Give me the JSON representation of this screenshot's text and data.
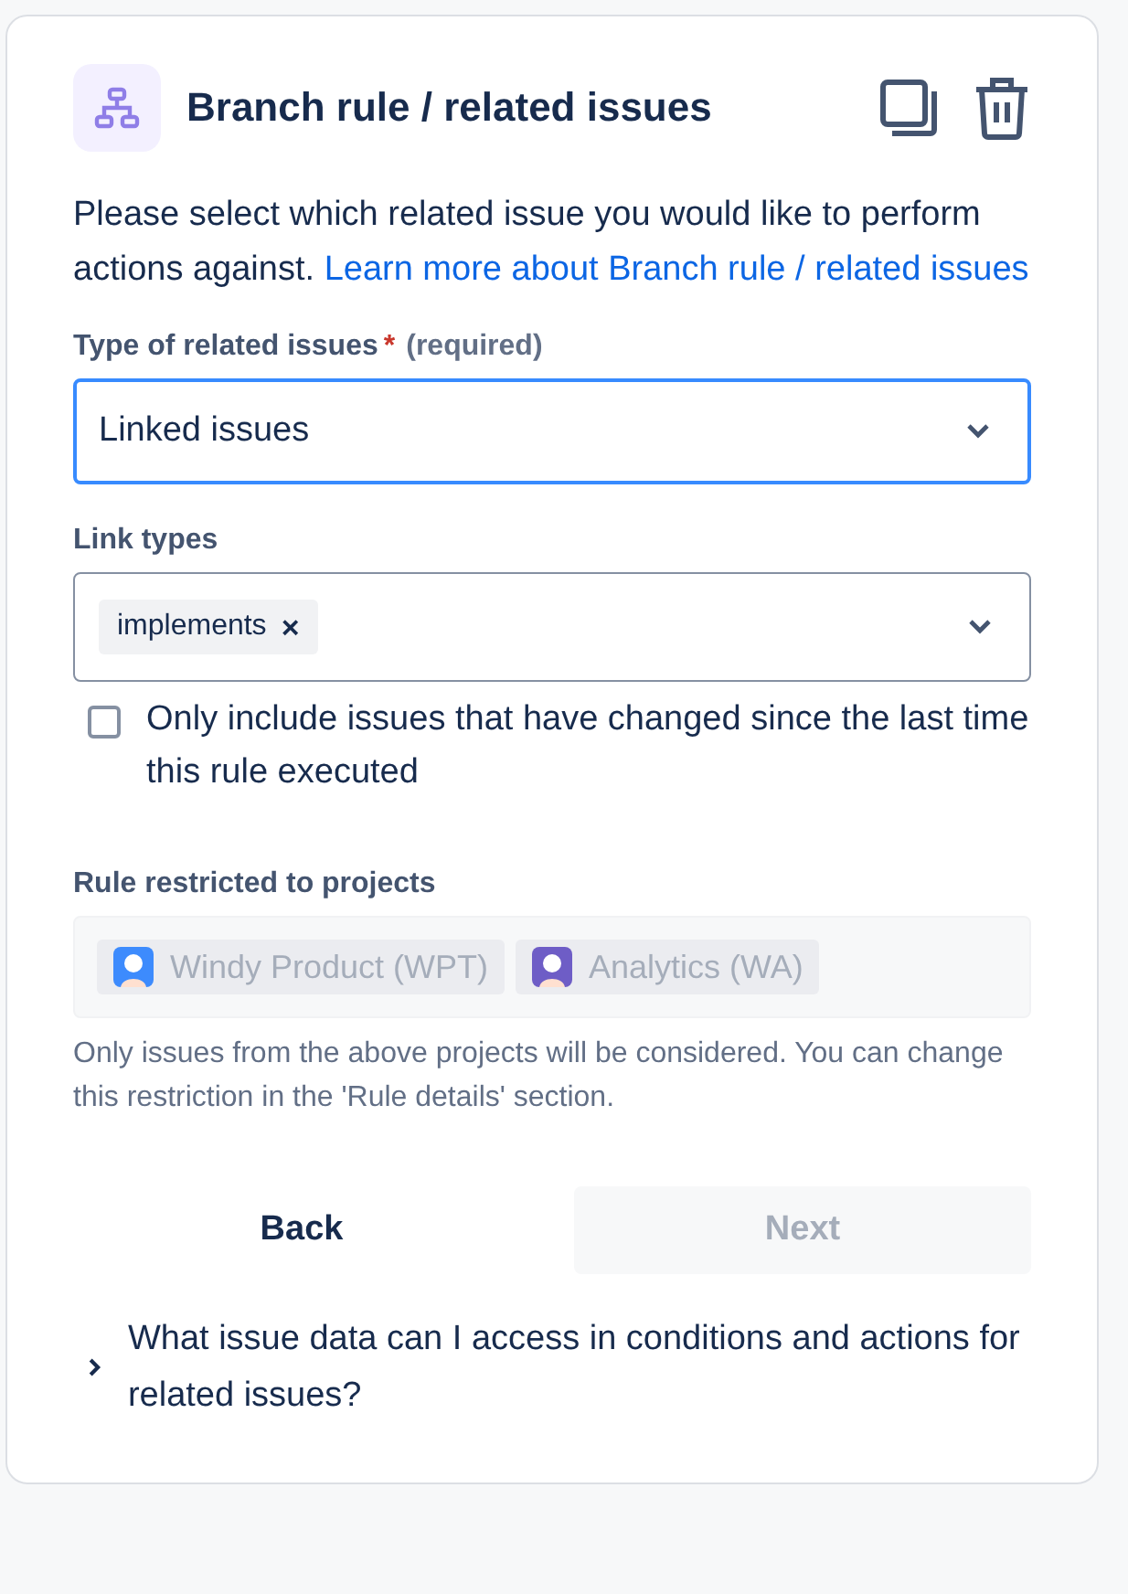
{
  "header": {
    "title": "Branch rule / related issues"
  },
  "description": {
    "text": "Please select which related issue you would like to perform actions against.",
    "link": "Learn more about Branch rule / related issues"
  },
  "type_field": {
    "label": "Type of related issues",
    "required_mark": "*",
    "required_note": "(required)",
    "value": "Linked issues",
    "focused": true
  },
  "link_types": {
    "label": "Link types",
    "tags": [
      {
        "label": "implements",
        "remove": "×"
      }
    ],
    "focused": false
  },
  "checkbox": {
    "label": "Only include issues that have changed since the last time this rule executed",
    "checked": false
  },
  "projects": {
    "label": "Rule restricted to projects",
    "disabled": true,
    "items": [
      {
        "name": "Windy Product (WPT)",
        "color": "#3d8bfd"
      },
      {
        "name": "Analytics (WA)",
        "color": "#6e5dc6"
      }
    ],
    "help": "Only issues from the above projects will be considered. You can change this restriction in the 'Rule details' section."
  },
  "buttons": [
    {
      "label": "Back",
      "disabled": false
    },
    {
      "label": "Next",
      "disabled": true
    }
  ],
  "expander": {
    "label": "What issue data can I access in conditions and actions for related issues?",
    "expanded": false
  }
}
